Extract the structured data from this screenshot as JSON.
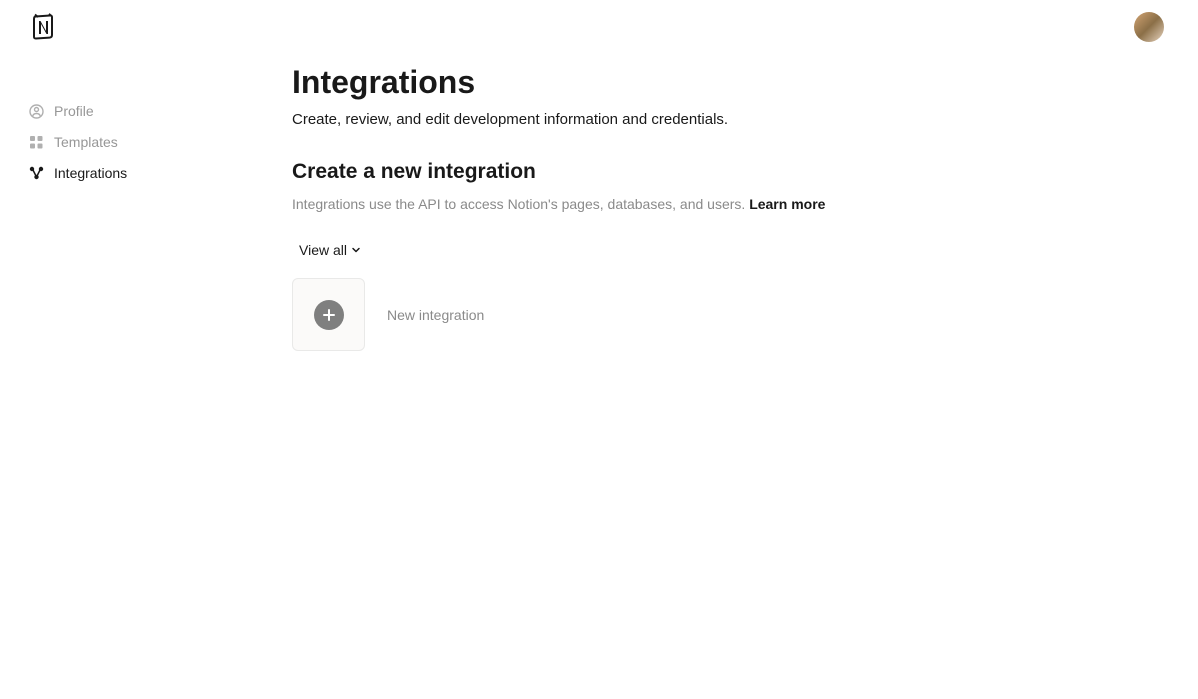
{
  "sidebar": {
    "items": [
      {
        "label": "Profile"
      },
      {
        "label": "Templates"
      },
      {
        "label": "Integrations"
      }
    ]
  },
  "main": {
    "title": "Integrations",
    "subtitle": "Create, review, and edit development information and credentials.",
    "section_title": "Create a new integration",
    "section_description": "Integrations use the API to access Notion's pages, databases, and users. ",
    "learn_more": "Learn more",
    "view_all": "View all",
    "new_integration": "New integration"
  }
}
